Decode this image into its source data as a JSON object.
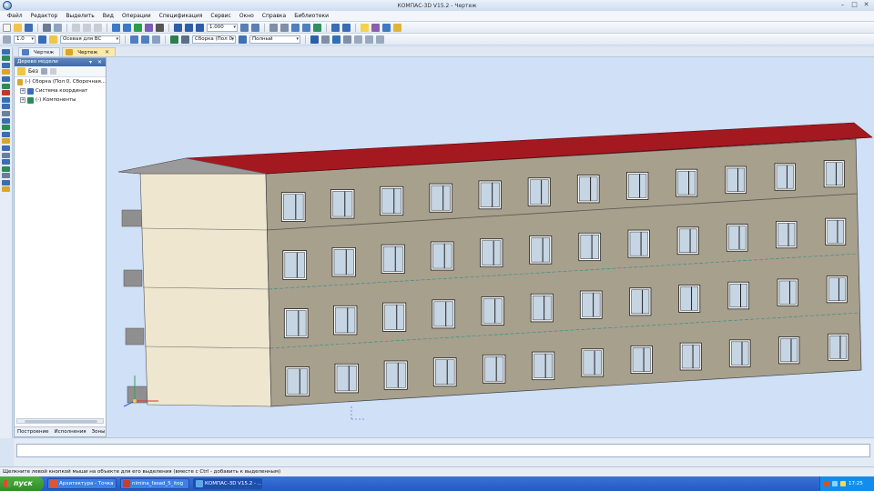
{
  "window": {
    "title": "КОМПАС-3D V15.2 - Чертеж",
    "min_glyph": "–",
    "max_glyph": "□",
    "close_glyph": "✕"
  },
  "menu": [
    "Файл",
    "Редактор",
    "Выделить",
    "Вид",
    "Операции",
    "Спецификация",
    "Сервис",
    "Окно",
    "Справка",
    "Библиотеки"
  ],
  "toolbar": {
    "zoom_value": "1.000",
    "layer_value": "1.0",
    "style_value": "Осевая для ВС",
    "part_value": "Сборка (Пол 0, 0",
    "view_value": "Полный"
  },
  "doc_tabs": [
    {
      "label": "Чертеж",
      "active": false
    },
    {
      "label": "Чертеж",
      "active": true
    }
  ],
  "tree_panel": {
    "title": "Дерево модели",
    "header_buttons": "▾ ✕",
    "tools_label": "Без",
    "root": "(-) Сборка (Пол 0, Сборочная...",
    "children": [
      "Система координат",
      "(-) Компоненты"
    ],
    "bottom_tabs": [
      "Построение",
      "Исполнения",
      "Зоны"
    ]
  },
  "status_text": "Щелкните левой кнопкой мыши на объекте для его выделения (вместе с Ctrl - добавить к выделенным)",
  "taskbar": {
    "start_label": "пуск",
    "items": [
      {
        "label": "Архитектура - Точка",
        "active": false
      },
      {
        "label": "nimina_fasad_5_itog",
        "active": false
      },
      {
        "label": "КОМПАС-3D V15.2 - ...",
        "active": true
      }
    ],
    "clock": "17:25"
  },
  "colors": {
    "viewport_bg": "#cfe0f7",
    "roof": "#a41920",
    "facade": "#a7a08d",
    "end_wall": "#efe6cf",
    "window_glass": "#c6d5e3"
  }
}
